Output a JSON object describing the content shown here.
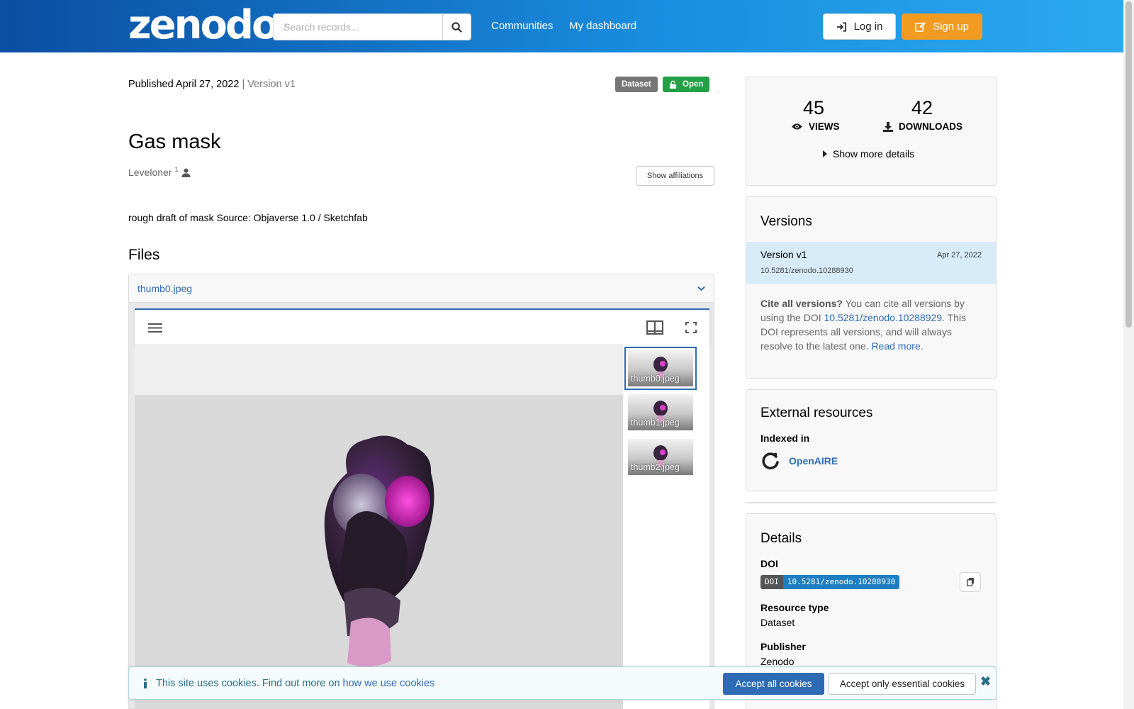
{
  "header": {
    "logo": "zenodo",
    "search_placeholder": "Search records...",
    "nav": [
      "Communities",
      "My dashboard"
    ],
    "login_label": "Log in",
    "signup_label": "Sign up"
  },
  "record": {
    "published": "Published April 27, 2022",
    "version": "| Version v1",
    "badge_type": "Dataset",
    "badge_access": "Open",
    "title": "Gas mask",
    "creator": "Leveloner",
    "creator_sup": "1",
    "show_affiliations": "Show affiliations",
    "description": "rough draft of mask Source: Objaverse 1.0 / Sketchfab"
  },
  "files": {
    "heading": "Files",
    "current_file": "thumb0.jpeg",
    "thumbnails": [
      "thumb0.jpeg",
      "thumb1.jpeg",
      "thumb2.jpeg"
    ]
  },
  "stats": {
    "views": "45",
    "views_label": "VIEWS",
    "downloads": "42",
    "downloads_label": "DOWNLOADS",
    "show_more": "Show more details"
  },
  "versions": {
    "heading": "Versions",
    "item_label": "Version v1",
    "item_date": "Apr 27, 2022",
    "item_doi": "10.5281/zenodo.10288930",
    "cite_bold": "Cite all versions?",
    "cite_text1": "You can cite all versions by using the DOI",
    "cite_doi": "10.5281/zenodo.10288929",
    "cite_text2": ". This DOI represents all versions, and will always resolve to the latest one.",
    "read_more": "Read more"
  },
  "external": {
    "heading": "External resources",
    "indexed_in": "Indexed in",
    "openaire": "OpenAIRE"
  },
  "details": {
    "heading": "Details",
    "doi_label": "DOI",
    "doi_badge_left": "DOI",
    "doi_value": "10.5281/zenodo.10288930",
    "resource_type_label": "Resource type",
    "resource_type": "Dataset",
    "publisher_label": "Publisher",
    "publisher": "Zenodo"
  },
  "cookie": {
    "text": "This site uses cookies. Find out more on",
    "link": "how we use cookies",
    "accept_all": "Accept all cookies",
    "accept_essential": "Accept only essential cookies"
  },
  "colors": {
    "brand_blue": "#0b4ea2",
    "signup_orange": "#f29b23",
    "open_green": "#21a044",
    "link_blue": "#2e6bb5"
  }
}
